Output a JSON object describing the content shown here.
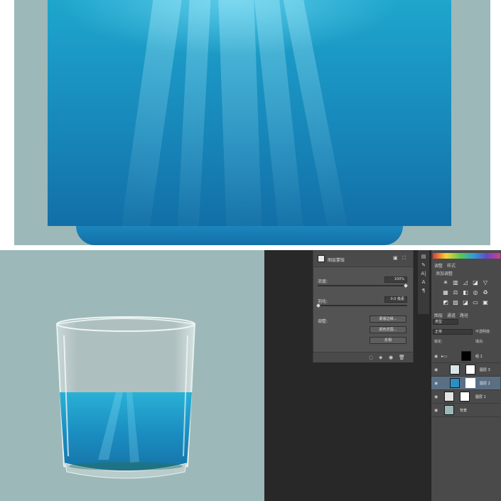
{
  "properties": {
    "title": "图层蒙版",
    "density_label": "浓度:",
    "density_value": "100%",
    "feather_label": "羽化:",
    "feather_value": "0.0 像素",
    "refine_label": "调整:",
    "mask_edge_button": "蒙版边缘...",
    "color_range_button": "颜色范围...",
    "invert_button": "反相"
  },
  "adjustments": {
    "tab1": "调整",
    "tab2": "样式",
    "add_label": "添加调整"
  },
  "layers_panel": {
    "tab_layers": "图层",
    "tab_channels": "通道",
    "tab_paths": "路径",
    "filter_kind": "类型",
    "blend_mode": "正常",
    "opacity_label": "不透明度:",
    "lock_label": "锁定:",
    "fill_label": "填充:",
    "layers": [
      {
        "name": "组 1",
        "kind": "group"
      },
      {
        "name": "图层 3",
        "kind": "water"
      },
      {
        "name": "图层 2",
        "kind": "water",
        "selected": true
      },
      {
        "name": "图层 1",
        "kind": "glass"
      },
      {
        "name": "背景",
        "kind": "background"
      }
    ]
  },
  "toolbar": {
    "text_tool": "A|",
    "type_tool": "A"
  },
  "colors": {
    "canvas_bg": "#9db8b8",
    "ocean": "#1a93c2",
    "panel": "#535353",
    "selected_layer": "#5a6f84"
  }
}
